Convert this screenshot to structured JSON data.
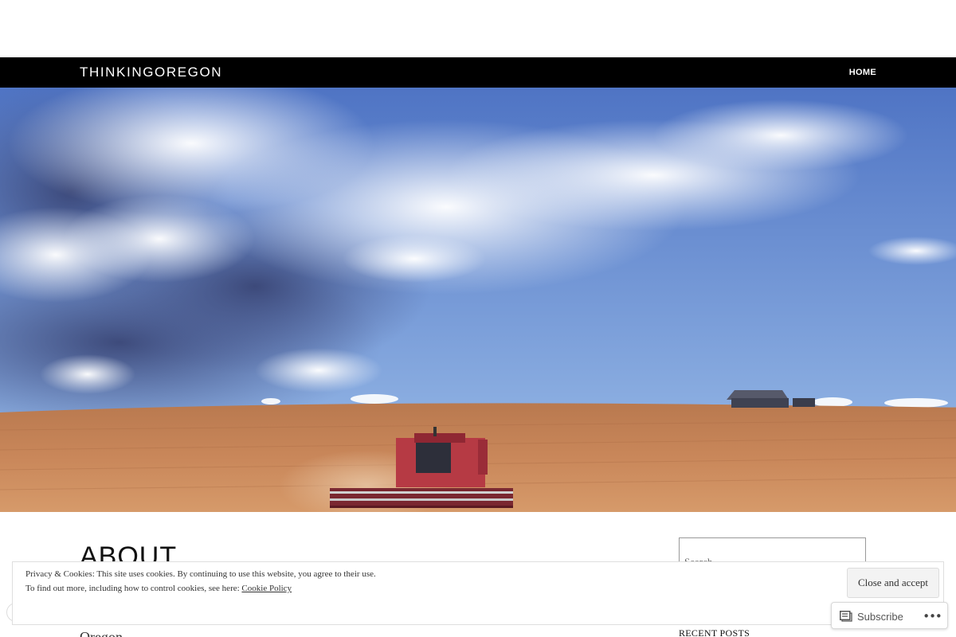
{
  "header": {
    "site_title": "THINKINGOREGON",
    "nav": {
      "home_label": "HOME"
    }
  },
  "hero": {
    "icon": "wheat-field-combine-photo",
    "colors": {
      "sky_top": "#4f74c4",
      "sky_bottom": "#9ec0ea",
      "field": "#c9875a",
      "combine": "#b63a44"
    }
  },
  "main": {
    "title": "ABOUT",
    "subtitle": "Oregon"
  },
  "sidebar": {
    "search_placeholder": "Search …",
    "recent_posts_heading": "RECENT POSTS"
  },
  "cookie_banner": {
    "line1": "Privacy & Cookies: This site uses cookies. By continuing to use this website, you agree to their use.",
    "line2_prefix": "To find out more, including how to control cookies, see here: ",
    "link_label": "Cookie Policy",
    "accept_label": "Close and accept"
  },
  "subscribe": {
    "label": "Subscribe",
    "icon": "reader-icon",
    "more_icon": "ellipsis-icon"
  }
}
